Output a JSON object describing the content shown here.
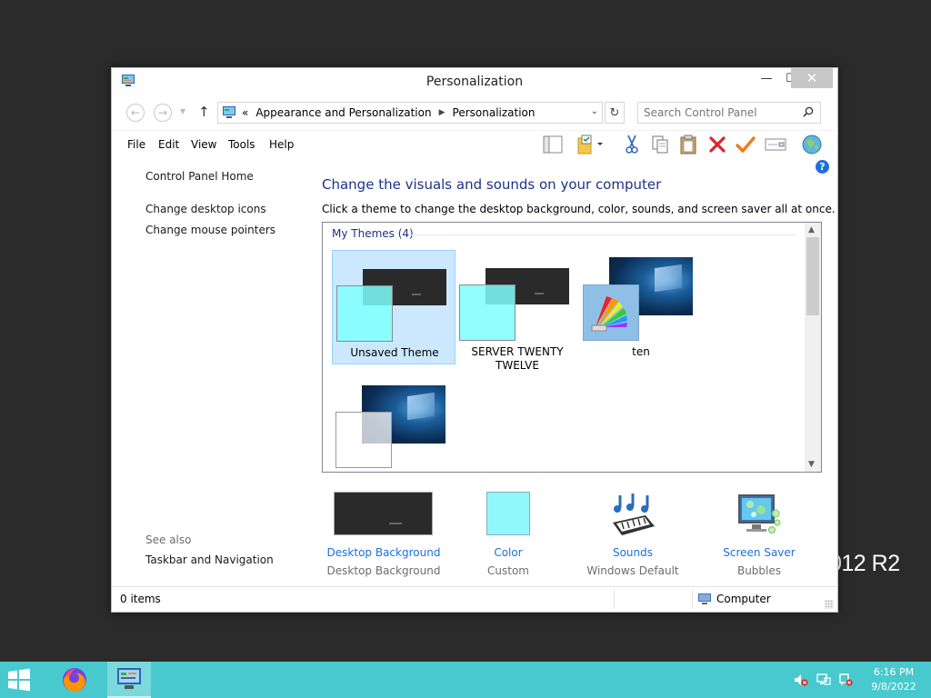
{
  "desktop": {
    "wallpaper_text": "012 R2"
  },
  "window": {
    "title": "Personalization",
    "controls": {
      "minimize": "—",
      "maximize": "☐",
      "close": "✕"
    }
  },
  "address": {
    "overflow": "«",
    "crumbs": [
      "Appearance and Personalization",
      "Personalization"
    ],
    "search_placeholder": "Search Control Panel"
  },
  "menu": [
    "File",
    "Edit",
    "View",
    "Tools",
    "Help"
  ],
  "toolbar_icons": [
    "layout-icon",
    "folder-properties-icon",
    "cut-icon",
    "copy-icon",
    "paste-icon",
    "delete-icon",
    "check-icon",
    "properties-icon",
    "web-icon"
  ],
  "sidebar": {
    "links": [
      "Control Panel Home",
      "Change desktop icons",
      "Change mouse pointers"
    ],
    "see_also": "See also",
    "see_also_links": [
      "Taskbar and Navigation"
    ]
  },
  "main": {
    "heading": "Change the visuals and sounds on your computer",
    "description": "Click a theme to change the desktop background, color, sounds, and screen saver all at once.",
    "group_label": "My Themes (4)",
    "themes": [
      {
        "name": "Unsaved Theme",
        "selected": true
      },
      {
        "name": "SERVER TWENTY TWELVE",
        "selected": false
      },
      {
        "name": "ten",
        "selected": false
      },
      {
        "name": "",
        "selected": false
      }
    ]
  },
  "settings": [
    {
      "link": "Desktop Background",
      "value": "Desktop Background"
    },
    {
      "link": "Color",
      "value": "Custom"
    },
    {
      "link": "Sounds",
      "value": "Windows Default"
    },
    {
      "link": "Screen Saver",
      "value": "Bubbles"
    }
  ],
  "status": {
    "items": "0 items",
    "location": "Computer"
  },
  "taskbar": {
    "apps": [
      "firefox-icon",
      "control-panel-icon"
    ],
    "clock_time": "6:16 PM",
    "clock_date": "9/8/2022"
  },
  "colors": {
    "accent_link": "#1e6fd9",
    "heading": "#1e3287",
    "selection": "#cce8ff",
    "taskbar": "#48c9cd"
  }
}
